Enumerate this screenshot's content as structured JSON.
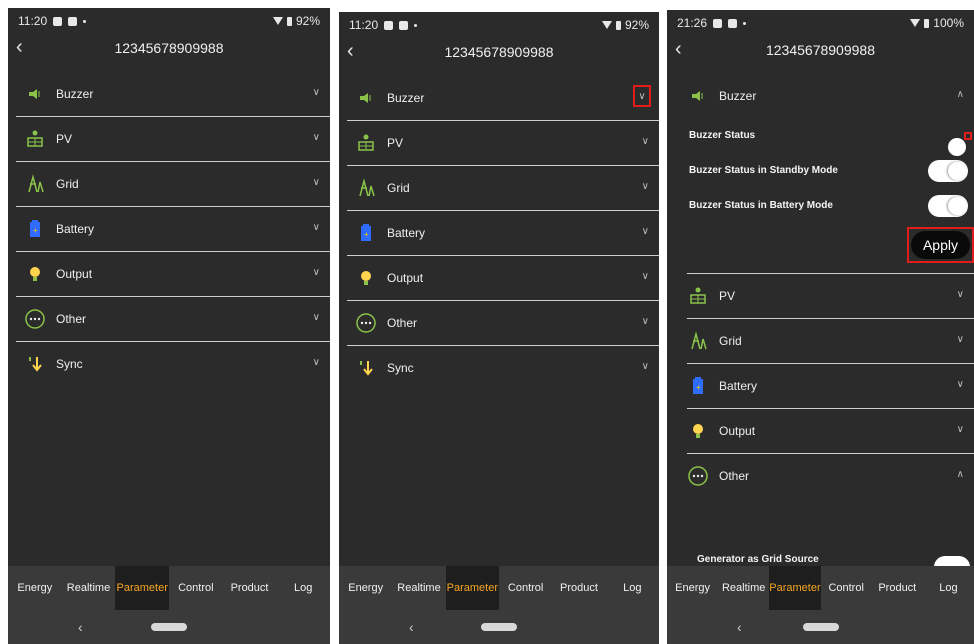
{
  "phones": [
    {
      "status": {
        "time": "11:20",
        "battery": "92%"
      },
      "title": "12345678909988",
      "items": [
        "Buzzer",
        "PV",
        "Grid",
        "Battery",
        "Output",
        "Other",
        "Sync"
      ],
      "tabs": [
        "Energy",
        "Realtime",
        "Parameter",
        "Control",
        "Product",
        "Log"
      ],
      "active_tab": "Parameter"
    },
    {
      "status": {
        "time": "11:20",
        "battery": "92%"
      },
      "title": "12345678909988",
      "items": [
        "Buzzer",
        "PV",
        "Grid",
        "Battery",
        "Output",
        "Other",
        "Sync"
      ],
      "tabs": [
        "Energy",
        "Realtime",
        "Parameter",
        "Control",
        "Product",
        "Log"
      ],
      "active_tab": "Parameter"
    },
    {
      "status": {
        "time": "21:26",
        "battery": "100%"
      },
      "title": "12345678909988",
      "buzzer": {
        "label": "Buzzer",
        "settings": [
          {
            "label": "Buzzer Status",
            "on": true
          },
          {
            "label": "Buzzer Status in Standby Mode",
            "on": false
          },
          {
            "label": "Buzzer Status in Battery Mode",
            "on": false
          }
        ],
        "apply": "Apply"
      },
      "items": [
        "PV",
        "Grid",
        "Battery",
        "Output",
        "Other"
      ],
      "other_sub": "Generator as Grid Source",
      "tabs": [
        "Energy",
        "Realtime",
        "Parameter",
        "Control",
        "Product",
        "Log"
      ],
      "active_tab": "Parameter"
    }
  ],
  "icons": {
    "buzzer": "speaker-icon",
    "pv": "solar-panel-icon",
    "grid": "grid-tower-icon",
    "battery": "battery-icon",
    "output": "lightbulb-icon",
    "other": "more-circle-icon",
    "sync": "sync-arrow-icon"
  },
  "colors": {
    "accent": "#f5a623",
    "background": "#2b2b2b",
    "highlight": "#e01c1c",
    "icon_green": "#8bc34a"
  }
}
